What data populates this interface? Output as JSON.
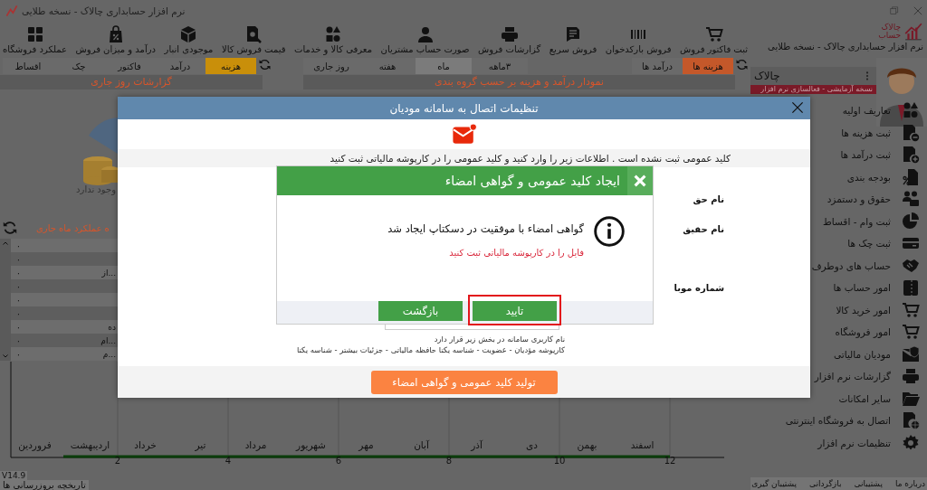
{
  "window": {
    "title": "نرم افزار حسابداری چالاک - نسخه طلایی"
  },
  "brand": {
    "logo_text": "چالاک",
    "logo_subtext": "حساب",
    "caption": "نرم افزار حسابداری چالاک - نسخه طلایی"
  },
  "toolbar": [
    "ثبت فاکتور فروش",
    "فروش بارکدخوان",
    "فروش سریع",
    "گزارشات فروش",
    "صورت حساب مشتریان",
    "معرفی کالا و خدمات",
    "قیمت فروش کالا",
    "موجودی انبار",
    "درآمد و میزان فروش",
    "عملکرد فروشگاه"
  ],
  "income_expense_tabs": [
    {
      "label": "هزینه ها",
      "selected": true
    },
    {
      "label": "درآمد ها",
      "selected": false
    }
  ],
  "period_tabs": [
    {
      "label": "۳ماهه",
      "selected": false
    },
    {
      "label": "ماه",
      "selected": true
    },
    {
      "label": "هفته",
      "selected": false
    },
    {
      "label": "روز جاری",
      "selected": false
    }
  ],
  "daily_tabs": [
    {
      "label": "هزینه",
      "selected": true
    },
    {
      "label": "درآمد",
      "selected": false
    },
    {
      "label": "فاکتور",
      "selected": false
    },
    {
      "label": "چک",
      "selected": false
    },
    {
      "label": "اقساط",
      "selected": false
    }
  ],
  "group_chart": {
    "title": "نمودار درآمد و هزینه بر حسب گروه بندی"
  },
  "daily_report": {
    "title": "گزارشات روز جاری",
    "empty_text": "وجود ندارد"
  },
  "monthly_table": {
    "title": "ه عملکرد ماه جاری",
    "rows": [
      {
        "value": "۰"
      },
      {
        "value": "۰"
      },
      {
        "value": "۰",
        "label": "از..."
      },
      {
        "value": "۰"
      },
      {
        "value": "۰"
      },
      {
        "value": "۰"
      },
      {
        "value": "۰",
        "label": "ده"
      },
      {
        "value": "۰",
        "label": "ام..."
      },
      {
        "value": "۰",
        "label": "م..."
      }
    ]
  },
  "monthly_chart": {
    "months": [
      "اسفند",
      "بهمن",
      "دی",
      "آذر",
      "آبان",
      "مهر",
      "شهریور",
      "مرداد",
      "تیر",
      "خرداد",
      "اردیبهشت",
      "فروردین"
    ],
    "x_ticks": [
      "12",
      "10",
      "8",
      "6",
      "4",
      "2"
    ]
  },
  "footer": {
    "version": "V14.9",
    "history_link": "تاریخچه بروزرسانی ها"
  },
  "sidebar": {
    "user": "چالاک",
    "trial_notice": "نسخه آزمایشی - فعالسازی نرم افزار",
    "items": [
      "تعاریف اولیه",
      "ثبت هزینه ها",
      "ثبت درآمد ها",
      "بودجه بندی",
      "حقوق و دستمزد",
      "ثبت وام - اقساط",
      "ثبت چک ها",
      "حساب های دوطرف",
      "امور حساب ها",
      "امور خرید کالا",
      "امور فروشگاه",
      "مودیان مالیاتی",
      "گزارشات نرم افزار",
      "سایر امکانات",
      "اتصال به فروشگاه اینترنتی",
      "تنظیمات نرم افزار"
    ],
    "bottom_links": [
      "درباره ما",
      "پشتیبانی",
      "بازگردانی",
      "پشتیبان گیری"
    ]
  },
  "settings_dialog": {
    "title": "تنظیمات اتصال به سامانه مودیان",
    "notice": "کلید عمومی ثبت نشده است . اطلاعات زیر را وارد کنید و کلید عمومی را در کارپوشه مالیاتی ثبت کنید",
    "fields": [
      {
        "label": "نام حق"
      },
      {
        "label": "نام حقیق"
      },
      {
        "label": "شماره موبا"
      }
    ],
    "hints": [
      "نام کاربری سامانه در بخش زیر قرار دارد",
      "کارپوشه مؤدیان - عضویت - شناسه یکتا حافظه مالیاتی - جزئیات بیشتر - شناسه یکتا"
    ],
    "generate_button": "تولید کلید عمومی و گواهی امضاء"
  },
  "message_dialog": {
    "title": "ایجاد کلید عمومی و گواهی امضاء",
    "message": "گواهی امضاء با موفقیت در دسکتاپ ایجاد شد",
    "warning": "فایل را در کارپوشه مالیاتی ثبت کنید",
    "buttons": [
      {
        "label": "تایید",
        "highlighted": true
      },
      {
        "label": "بازگشت",
        "highlighted": false
      }
    ]
  }
}
